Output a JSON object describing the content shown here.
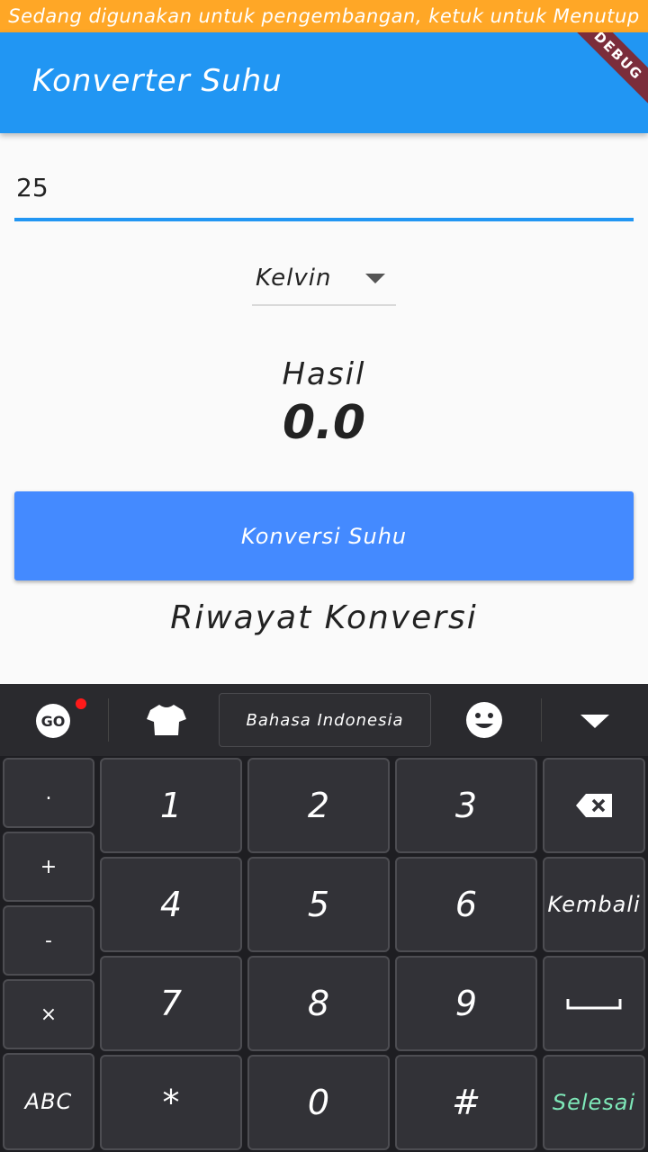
{
  "status_bar": {
    "text": "Sedang digunakan untuk pengembangan, ketuk untuk Menutup"
  },
  "app_bar": {
    "title": "Konverter Suhu",
    "debug_label": "DEBUG"
  },
  "input": {
    "value": "25"
  },
  "dropdown": {
    "selected": "Kelvin"
  },
  "result": {
    "label": "Hasil",
    "value": "0.0"
  },
  "convert_button": {
    "label": "Konversi Suhu"
  },
  "history": {
    "title": "Riwayat Konversi"
  },
  "keyboard": {
    "toolbar": {
      "go_label": "GO",
      "language": "Bahasa Indonesia"
    },
    "side_keys": [
      ".",
      "+",
      "-",
      "×",
      "ABC"
    ],
    "number_keys": [
      "1",
      "2",
      "3",
      "4",
      "5",
      "6",
      "7",
      "8",
      "9",
      "*",
      "0",
      "#"
    ],
    "enter_label": "Kembali",
    "done_label": "Selesai"
  },
  "colors": {
    "status_bar": "#ffa726",
    "app_bar": "#2196f3",
    "button": "#448aff",
    "keyboard_bg": "#1e1e22",
    "done_text": "#7ee8b8"
  }
}
